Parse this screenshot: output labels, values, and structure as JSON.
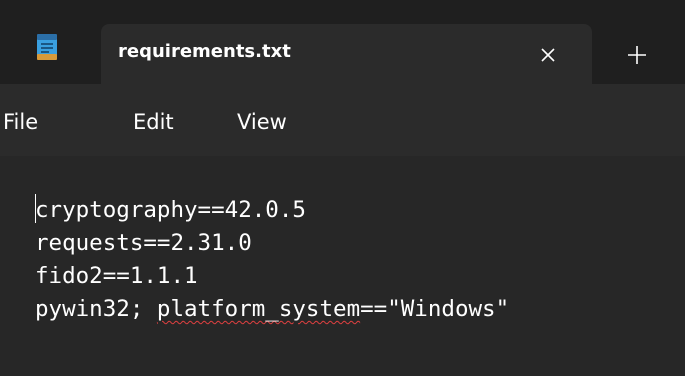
{
  "window": {
    "tab_title": "requirements.txt",
    "app_icon": "notepad-icon",
    "close_icon": "close-icon",
    "new_tab_icon": "plus-icon"
  },
  "menu": {
    "file": "File",
    "edit": "Edit",
    "view": "View"
  },
  "editor": {
    "lines": [
      "cryptography==42.0.5",
      "requests==2.31.0",
      "fido2==1.1.1"
    ],
    "line4": {
      "prefix": "pywin32; ",
      "misspelled": "platform_system",
      "suffix": "==\"Windows\""
    }
  },
  "colors": {
    "titlebar": "#1f1f1f",
    "tab": "#2b2b2b",
    "editor_bg": "#272727",
    "spellcheck": "#e04040"
  }
}
